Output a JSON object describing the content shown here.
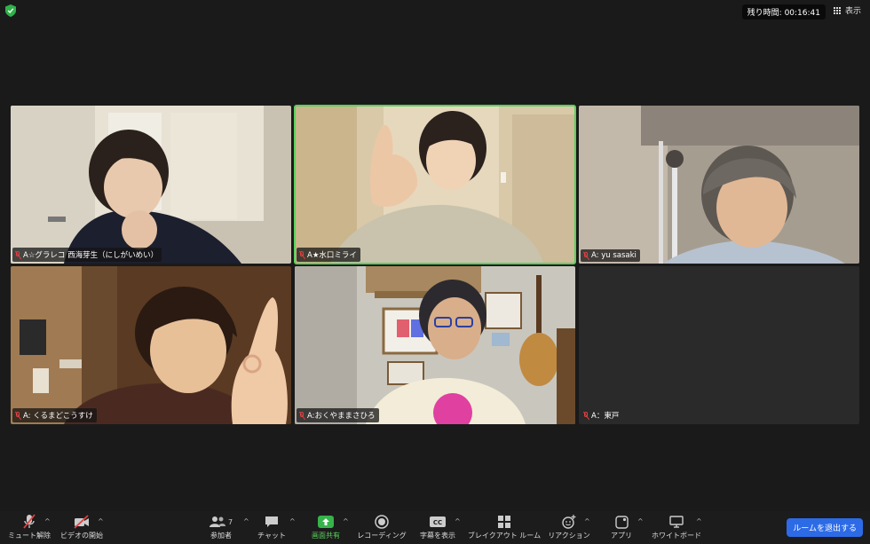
{
  "header": {
    "timer_text": "残り時間: 00:16:41",
    "view_label": "表示"
  },
  "participants": [
    {
      "name": "A☆グラレコ 西海芽生（にしがいめい）",
      "active": false
    },
    {
      "name": "A★水口ミライ",
      "active": true
    },
    {
      "name": "A: yu sasaki",
      "active": false
    },
    {
      "name": "A: くるまどこうすけ",
      "active": false
    },
    {
      "name": "A:おくやままさひろ",
      "active": false
    },
    {
      "name": "A：東戸",
      "active": false,
      "video": false
    }
  ],
  "toolbar": {
    "mute_label": "ミュート解除",
    "video_label": "ビデオの開始",
    "participants_label": "参加者",
    "participants_count": "7",
    "chat_label": "チャット",
    "share_label": "画面共有",
    "record_label": "レコーディング",
    "captions_label": "字幕を表示",
    "breakout_label": "ブレイクアウト ルーム",
    "reactions_label": "リアクション",
    "apps_label": "アプリ",
    "whiteboard_label": "ホワイトボード",
    "leave_label": "ルームを退出する"
  },
  "colors": {
    "active_border": "#5cd05c",
    "share_green": "#36b34a",
    "leave_blue": "#2d6be6",
    "muted_red": "#e04040"
  }
}
